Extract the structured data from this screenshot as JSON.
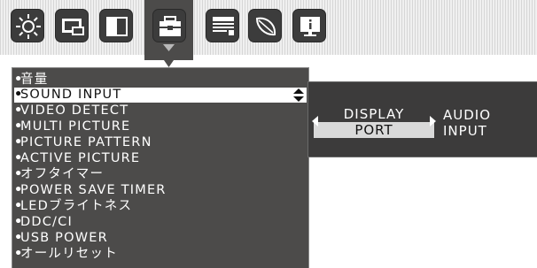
{
  "tabs": [
    {
      "icon": "brightness-icon"
    },
    {
      "icon": "screen-adjust-icon"
    },
    {
      "icon": "contrast-icon"
    },
    {
      "icon": "toolbox-icon",
      "selected": true
    },
    {
      "icon": "menu-tools-icon"
    },
    {
      "icon": "eco-leaf-icon"
    },
    {
      "icon": "information-icon"
    }
  ],
  "menu": {
    "items": [
      {
        "bullet": "•",
        "label": "音量"
      },
      {
        "bullet": "•",
        "label": "SOUND INPUT",
        "selected": true
      },
      {
        "bullet": "•",
        "label": "VIDEO DETECT"
      },
      {
        "bullet": "•",
        "label": "MULTI PICTURE"
      },
      {
        "bullet": "•",
        "label": "PICTURE PATTERN"
      },
      {
        "bullet": "•",
        "label": "ACTIVE PICTURE"
      },
      {
        "bullet": "•",
        "label": "オフタイマー"
      },
      {
        "bullet": "•",
        "label": "POWER SAVE TIMER"
      },
      {
        "bullet": "•",
        "label": "LEDブライトネス"
      },
      {
        "bullet": "•",
        "label": "DDC/CI"
      },
      {
        "bullet": "•",
        "label": "USB POWER"
      },
      {
        "bullet": "•",
        "label": "オールリセット"
      }
    ]
  },
  "submenu": {
    "selected_line1": "DISPLAY",
    "selected_line2": "PORT",
    "other_line1": "AUDIO",
    "other_line2": "INPUT"
  },
  "colors": {
    "panel": "#4c4b4a",
    "tab": "#3c3c3c",
    "highlight": "#ffffff"
  }
}
